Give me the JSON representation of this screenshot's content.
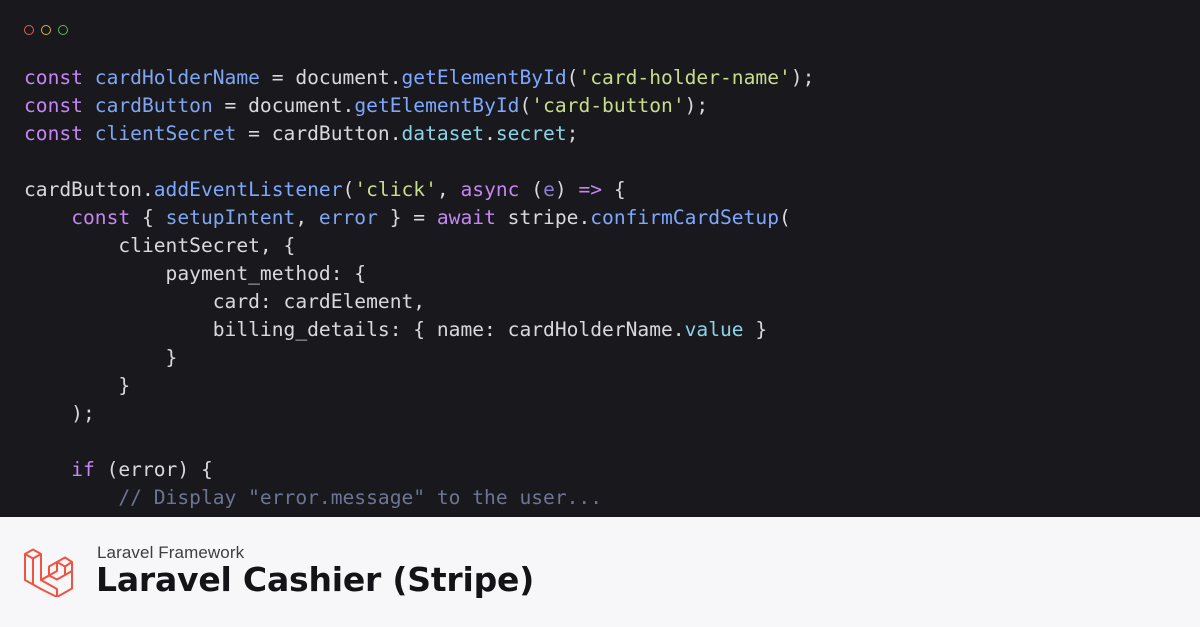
{
  "window": {
    "controls": [
      "close",
      "minimize",
      "maximize"
    ]
  },
  "code": {
    "lines": [
      [
        {
          "t": "const ",
          "c": "kw"
        },
        {
          "t": "cardHolderName",
          "c": "var"
        },
        {
          "t": " = document.",
          "c": "pl"
        },
        {
          "t": "getElementById",
          "c": "fn"
        },
        {
          "t": "(",
          "c": "pl"
        },
        {
          "t": "'card-holder-name'",
          "c": "str"
        },
        {
          "t": ");",
          "c": "pl"
        }
      ],
      [
        {
          "t": "const ",
          "c": "kw"
        },
        {
          "t": "cardButton",
          "c": "var"
        },
        {
          "t": " = document.",
          "c": "pl"
        },
        {
          "t": "getElementById",
          "c": "fn"
        },
        {
          "t": "(",
          "c": "pl"
        },
        {
          "t": "'card-button'",
          "c": "str"
        },
        {
          "t": ");",
          "c": "pl"
        }
      ],
      [
        {
          "t": "const ",
          "c": "kw"
        },
        {
          "t": "clientSecret",
          "c": "var"
        },
        {
          "t": " = cardButton.",
          "c": "pl"
        },
        {
          "t": "dataset",
          "c": "prop"
        },
        {
          "t": ".",
          "c": "pl"
        },
        {
          "t": "secret",
          "c": "prop"
        },
        {
          "t": ";",
          "c": "pl"
        }
      ],
      [],
      [
        {
          "t": "cardButton.",
          "c": "pl"
        },
        {
          "t": "addEventListener",
          "c": "fn"
        },
        {
          "t": "(",
          "c": "pl"
        },
        {
          "t": "'click'",
          "c": "str"
        },
        {
          "t": ", ",
          "c": "pl"
        },
        {
          "t": "async",
          "c": "kw"
        },
        {
          "t": " (",
          "c": "pl"
        },
        {
          "t": "e",
          "c": "param"
        },
        {
          "t": ") ",
          "c": "pl"
        },
        {
          "t": "=>",
          "c": "kw"
        },
        {
          "t": " {",
          "c": "pl"
        }
      ],
      [
        {
          "t": "    ",
          "c": "pl"
        },
        {
          "t": "const",
          "c": "kw"
        },
        {
          "t": " { ",
          "c": "pl"
        },
        {
          "t": "setupIntent",
          "c": "var"
        },
        {
          "t": ", ",
          "c": "pl"
        },
        {
          "t": "error",
          "c": "var"
        },
        {
          "t": " } = ",
          "c": "pl"
        },
        {
          "t": "await",
          "c": "kw"
        },
        {
          "t": " stripe.",
          "c": "pl"
        },
        {
          "t": "confirmCardSetup",
          "c": "fn"
        },
        {
          "t": "(",
          "c": "pl"
        }
      ],
      [
        {
          "t": "        clientSecret, {",
          "c": "pl"
        }
      ],
      [
        {
          "t": "            payment_method: {",
          "c": "pl"
        }
      ],
      [
        {
          "t": "                card: cardElement,",
          "c": "pl"
        }
      ],
      [
        {
          "t": "                billing_details: { name: cardHolderName.",
          "c": "pl"
        },
        {
          "t": "value",
          "c": "prop"
        },
        {
          "t": " }",
          "c": "pl"
        }
      ],
      [
        {
          "t": "            }",
          "c": "pl"
        }
      ],
      [
        {
          "t": "        }",
          "c": "pl"
        }
      ],
      [
        {
          "t": "    );",
          "c": "pl"
        }
      ],
      [],
      [
        {
          "t": "    ",
          "c": "pl"
        },
        {
          "t": "if",
          "c": "kw"
        },
        {
          "t": " (error) {",
          "c": "pl"
        }
      ],
      [
        {
          "t": "        // Display \"error.message\" to the user...",
          "c": "cmt"
        }
      ]
    ]
  },
  "footer": {
    "logo": "laravel-logo-icon",
    "subtitle": "Laravel Framework",
    "title": "Laravel Cashier (Stripe)"
  },
  "colors": {
    "editor_bg": "#19181c",
    "footer_bg": "#f7f7f9",
    "laravel_red": "#f05340",
    "keyword": "#c586f3",
    "function": "#7ea8ff",
    "string": "#c8de8a",
    "comment": "#6c7594"
  }
}
